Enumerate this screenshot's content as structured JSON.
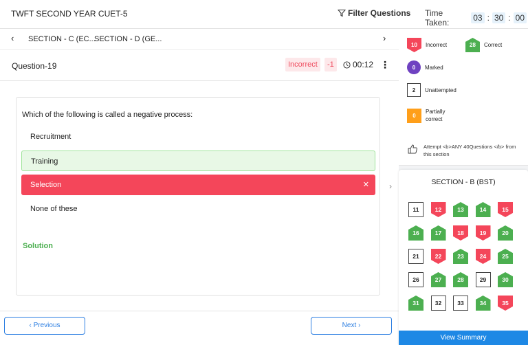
{
  "header": {
    "title": "TWFT SECOND YEAR CUET-5",
    "filter_label": "Filter Questions",
    "time_label": "Time Taken:",
    "time": [
      "03",
      "30",
      "00"
    ]
  },
  "tabs": {
    "items": [
      "SECTION - C (EC...",
      "SECTION - D (GE..."
    ]
  },
  "question": {
    "label": "Question-19",
    "status": "Incorrect",
    "marks": "-1",
    "time": "00:12",
    "text": "Which of the following is called a negative process:",
    "options": [
      "Recruitment",
      "Training",
      "Selection",
      "None of these"
    ],
    "correct_option": "Training",
    "selected_option": "Selection",
    "solution_label": "Solution"
  },
  "nav": {
    "previous": "Previous",
    "next": "Next"
  },
  "legend": {
    "incorrect": {
      "count": "10",
      "label": "Incorrect"
    },
    "correct": {
      "count": "28",
      "label": "Correct"
    },
    "marked": {
      "count": "0",
      "label": "Marked"
    },
    "unattempted": {
      "count": "2",
      "label": "Unattempted"
    },
    "partial": {
      "count": "0",
      "label": "Partially correct"
    },
    "attempt_note": "Attempt <b>ANY 40Questions </b> from this section"
  },
  "section_panel": {
    "title": "SECTION - B (BST)",
    "questions": [
      {
        "n": "11",
        "s": "unattempted"
      },
      {
        "n": "12",
        "s": "incorrect"
      },
      {
        "n": "13",
        "s": "correct"
      },
      {
        "n": "14",
        "s": "correct"
      },
      {
        "n": "15",
        "s": "incorrect"
      },
      {
        "n": "16",
        "s": "correct"
      },
      {
        "n": "17",
        "s": "correct"
      },
      {
        "n": "18",
        "s": "incorrect"
      },
      {
        "n": "19",
        "s": "incorrect"
      },
      {
        "n": "20",
        "s": "correct"
      },
      {
        "n": "21",
        "s": "unattempted"
      },
      {
        "n": "22",
        "s": "incorrect"
      },
      {
        "n": "23",
        "s": "correct"
      },
      {
        "n": "24",
        "s": "incorrect"
      },
      {
        "n": "25",
        "s": "correct"
      },
      {
        "n": "26",
        "s": "unattempted"
      },
      {
        "n": "27",
        "s": "correct"
      },
      {
        "n": "28",
        "s": "correct"
      },
      {
        "n": "29",
        "s": "unattempted"
      },
      {
        "n": "30",
        "s": "correct"
      },
      {
        "n": "31",
        "s": "correct"
      },
      {
        "n": "32",
        "s": "unattempted"
      },
      {
        "n": "33",
        "s": "unattempted"
      },
      {
        "n": "34",
        "s": "correct"
      },
      {
        "n": "35",
        "s": "incorrect"
      }
    ],
    "summary_button": "View Summary"
  },
  "colors": {
    "accent": "#2a7de1",
    "correct": "#4caf50",
    "incorrect": "#f4465a",
    "marked": "#6f42c1",
    "partial": "#ff9f1a"
  }
}
